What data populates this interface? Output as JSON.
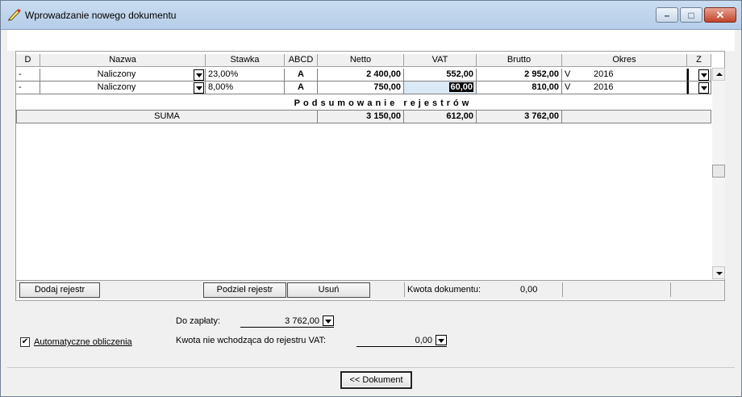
{
  "window": {
    "title": "Wprowadzanie nowego dokumentu",
    "icon": "pen-icon",
    "minimize_label": "–",
    "maximize_label": "□",
    "close_label": "✕"
  },
  "grid": {
    "columns": [
      "D",
      "Nazwa",
      "Stawka",
      "ABCD",
      "Netto",
      "VAT",
      "Brutto",
      "Okres",
      "Z"
    ],
    "rows": [
      {
        "d": "-",
        "nazwa": "Naliczony",
        "stawka": "23,00%",
        "abcd": "A",
        "netto": "2 400,00",
        "vat": "552,00",
        "brutto": "2 952,00",
        "okres_type": "V",
        "okres_year": "2016"
      },
      {
        "d": "-",
        "nazwa": "Naliczony",
        "stawka": "8,00%",
        "abcd": "A",
        "netto": "750,00",
        "vat": "60,00",
        "brutto": "810,00",
        "okres_type": "V",
        "okres_year": "2016"
      }
    ]
  },
  "summary": {
    "title": "Podsumowanie rejestrów",
    "label": "SUMA",
    "netto": "3 150,00",
    "vat": "612,00",
    "brutto": "3 762,00"
  },
  "actions": {
    "add_register": "Dodaj rejestr",
    "split_register": "Podziel rejestr",
    "delete": "Usuń",
    "doc_amount_label": "Kwota dokumentu:",
    "doc_amount_value": "0,00"
  },
  "payment": {
    "do_zaplaty_label": "Do zapłaty:",
    "do_zaplaty_value": "3 762,00",
    "auto_calc_label": "Automatyczne obliczenia",
    "auto_calc_checked": true,
    "kwota_nie_label": "Kwota nie wchodząca do rejestru VAT:",
    "kwota_nie_value": "0,00"
  },
  "footer": {
    "back_label": "<< Dokument"
  }
}
